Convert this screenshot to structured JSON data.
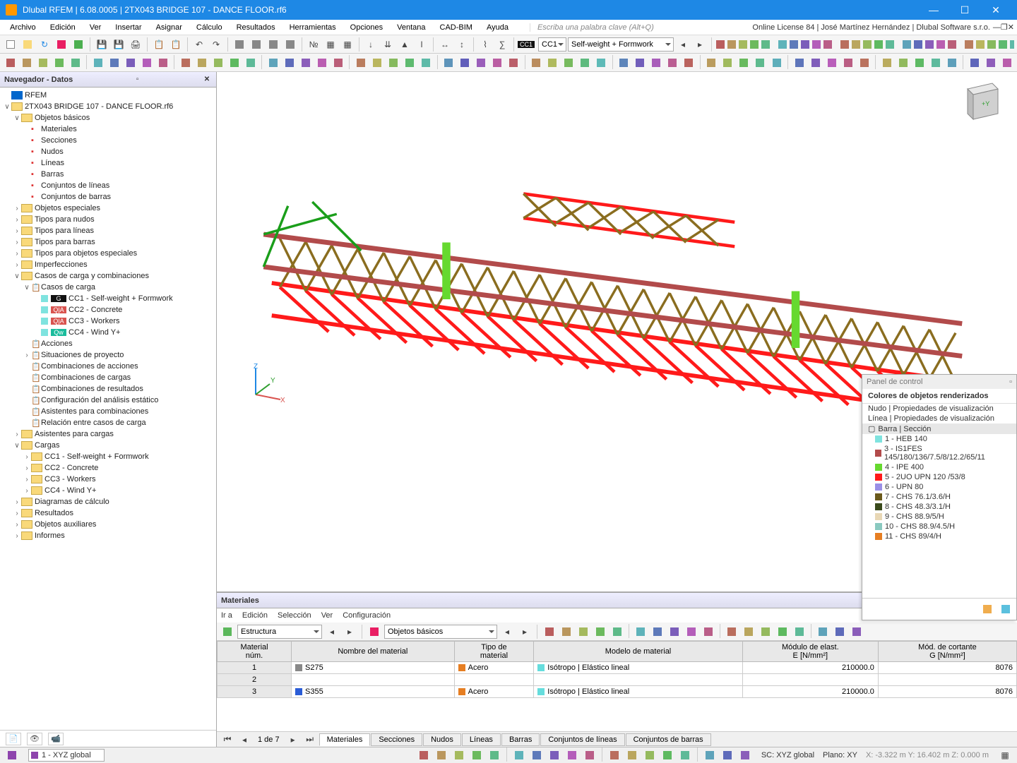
{
  "title": "Dlubal RFEM | 6.08.0005 | 2TX043 BRIDGE 107 - DANCE FLOOR.rf6",
  "menus": [
    "Archivo",
    "Edición",
    "Ver",
    "Insertar",
    "Asignar",
    "Cálculo",
    "Resultados",
    "Herramientas",
    "Opciones",
    "Ventana",
    "CAD-BIM",
    "Ayuda"
  ],
  "keyword_hint": "Escriba una palabra clave (Alt+Q)",
  "license": "Online License 84 | José Martínez Hernández | Dlubal Software s.r.o.",
  "cc_tag": "CC1",
  "cc_drop": "Self-weight + Formwork",
  "nav_title": "Navegador - Datos",
  "tree_root": "RFEM",
  "tree_file": "2TX043 BRIDGE 107 - DANCE FLOOR.rf6",
  "tree_basic": "Objetos básicos",
  "tree_basic_children": [
    "Materiales",
    "Secciones",
    "Nudos",
    "Líneas",
    "Barras",
    "Conjuntos de líneas",
    "Conjuntos de barras"
  ],
  "tree_mid": [
    "Objetos especiales",
    "Tipos para nudos",
    "Tipos para líneas",
    "Tipos para barras",
    "Tipos para objetos especiales",
    "Imperfecciones"
  ],
  "tree_lc": "Casos de carga y combinaciones",
  "tree_lc_cases": "Casos de carga",
  "lc_list": [
    {
      "tag": "G",
      "color": "#111",
      "label": "CC1 - Self-weight + Formwork"
    },
    {
      "tag": "Q|A",
      "color": "#d9534f",
      "label": "CC2 - Concrete"
    },
    {
      "tag": "Q|A",
      "color": "#d9534f",
      "label": "CC3 - Workers"
    },
    {
      "tag": "Qw",
      "color": "#1abc9c",
      "label": "CC4 - Wind Y+"
    }
  ],
  "tree_lc_rest": [
    "Acciones",
    "Situaciones de proyecto",
    "Combinaciones de acciones",
    "Combinaciones de cargas",
    "Combinaciones de resultados",
    "Configuración del análisis estático",
    "Asistentes para combinaciones",
    "Relación entre casos de carga"
  ],
  "tree_assist": "Asistentes para cargas",
  "tree_loads": "Cargas",
  "loads_children": [
    "CC1 - Self-weight + Formwork",
    "CC2 - Concrete",
    "CC3 - Workers",
    "CC4 - Wind Y+"
  ],
  "tree_extra": [
    "Diagramas de cálculo",
    "Resultados",
    "Objetos auxiliares",
    "Informes"
  ],
  "bp_title": "Materiales",
  "bp_menus": [
    "Ir a",
    "Edición",
    "Selección",
    "Ver",
    "Configuración"
  ],
  "bp_drop1": "Estructura",
  "bp_drop2": "Objetos básicos",
  "table_headers": [
    "Material\nnúm.",
    "Nombre del material",
    "Tipo de\nmaterial",
    "Modelo de material",
    "Módulo de elast.\nE [N/mm²]",
    "Mód. de cortante\nG [N/mm²]"
  ],
  "table_rows": [
    {
      "num": "1",
      "name": "S275",
      "name_color": "#888",
      "type": "Acero",
      "type_color": "#e67e22",
      "model": "Isótropo | Elástico lineal",
      "model_color": "#6dd",
      "E": "210000.0",
      "G": "8076"
    },
    {
      "num": "2",
      "name": "",
      "name_color": "",
      "type": "",
      "type_color": "",
      "model": "",
      "model_color": "",
      "E": "",
      "G": ""
    },
    {
      "num": "3",
      "name": "S355",
      "name_color": "#2a5cd6",
      "type": "Acero",
      "type_color": "#e67e22",
      "model": "Isótropo | Elástico lineal",
      "model_color": "#6dd",
      "E": "210000.0",
      "G": "8076"
    }
  ],
  "page_info": "1 de 7",
  "bp_tabs": [
    "Materiales",
    "Secciones",
    "Nudos",
    "Líneas",
    "Barras",
    "Conjuntos de líneas",
    "Conjuntos de barras"
  ],
  "ctrl_title": "Panel de control",
  "ctrl_sub": "Colores de objetos renderizados",
  "ctrl_groups": [
    "Nudo | Propiedades de visualización",
    "Línea | Propiedades de visualización",
    "Barra | Sección"
  ],
  "sections": [
    {
      "c": "#7fe3df",
      "t": "1 - HEB 140"
    },
    {
      "c": "#b24b4b",
      "t": "3 - IS1FES 145/180/136/7.5/8/12.2/65/11"
    },
    {
      "c": "#66d92f",
      "t": "4 - IPE 400"
    },
    {
      "c": "#ff1a1a",
      "t": "5 - 2UO UPN 120 /53/8"
    },
    {
      "c": "#9a8fe6",
      "t": "6 - UPN 80"
    },
    {
      "c": "#6b5a1c",
      "t": "7 - CHS 76.1/3.6/H"
    },
    {
      "c": "#3a4a1c",
      "t": "8 - CHS 48.3/3.1/H"
    },
    {
      "c": "#e8d7b5",
      "t": "9 - CHS 88.9/5/H"
    },
    {
      "c": "#8ac9c0",
      "t": "10 - CHS 88.9/4.5/H"
    },
    {
      "c": "#e67e22",
      "t": "11 - CHS 89/4/H"
    }
  ],
  "status_coord": "1 - XYZ global",
  "status_sc": "SC: XYZ global",
  "status_plane": "Plano: XY",
  "status_xyz": "X: -3.322 m   Y: 16.402 m   Z: 0.000 m"
}
